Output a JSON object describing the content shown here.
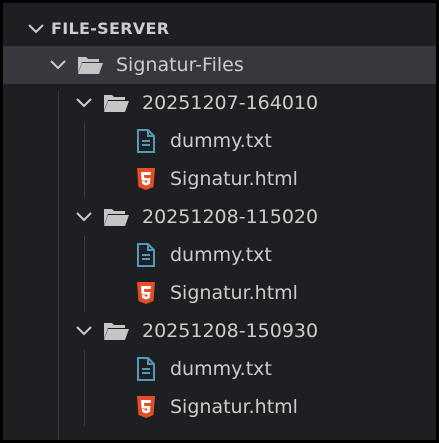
{
  "explorer": {
    "section_title": "FILE-SERVER",
    "root_folder": {
      "label": "Signatur-Files",
      "children": [
        {
          "label": "20251207-164010",
          "files": [
            {
              "label": "dummy.txt",
              "icon": "text-file-icon"
            },
            {
              "label": "Signatur.html",
              "icon": "html5-icon"
            }
          ]
        },
        {
          "label": "20251208-115020",
          "files": [
            {
              "label": "dummy.txt",
              "icon": "text-file-icon"
            },
            {
              "label": "Signatur.html",
              "icon": "html5-icon"
            }
          ]
        },
        {
          "label": "20251208-150930",
          "files": [
            {
              "label": "dummy.txt",
              "icon": "text-file-icon"
            },
            {
              "label": "Signatur.html",
              "icon": "html5-icon"
            }
          ]
        }
      ]
    }
  },
  "colors": {
    "background": "#1e1f22",
    "selected_row": "#37373d",
    "text": "#cccccc",
    "text_file_icon": "#519aba",
    "html_icon": "#e44d26",
    "folder_icon": "#c5c5c5"
  }
}
